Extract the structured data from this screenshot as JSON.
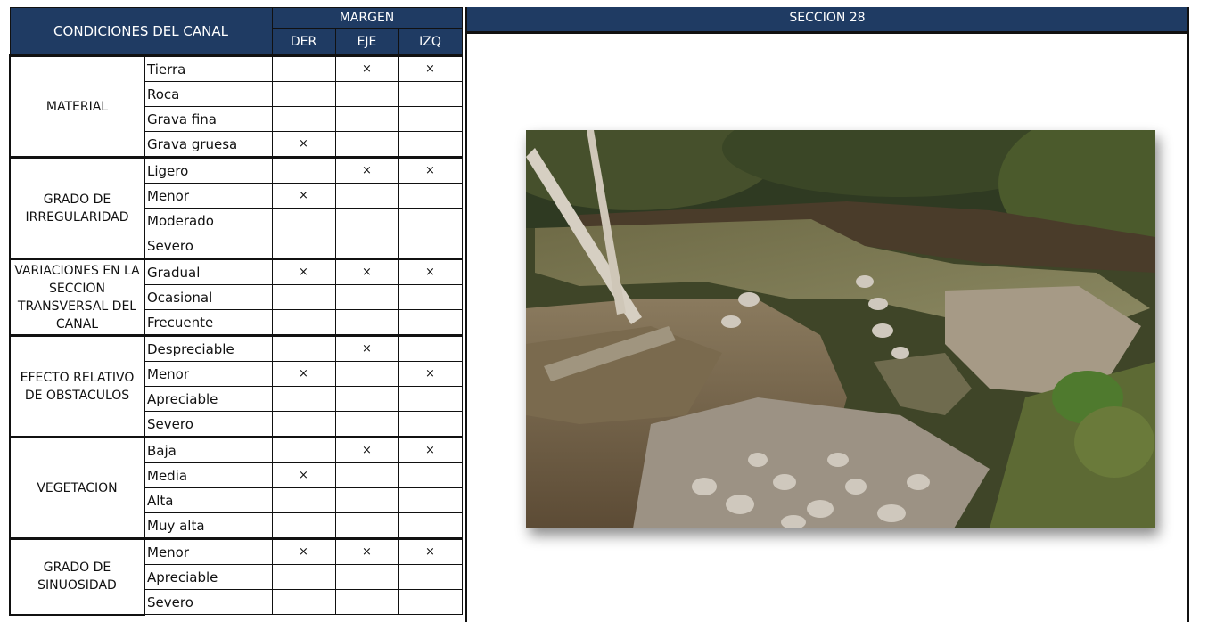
{
  "table": {
    "header_title": "CONDICIONES DEL CANAL",
    "margin_label": "MARGEN",
    "columns": [
      "DER",
      "EJE",
      "IZQ"
    ],
    "mark_symbol": "×",
    "groups": [
      {
        "label": "MATERIAL",
        "rows": [
          {
            "option": "Tierra",
            "marks": [
              false,
              true,
              true
            ]
          },
          {
            "option": "Roca",
            "marks": [
              false,
              false,
              false
            ]
          },
          {
            "option": "Grava fina",
            "marks": [
              false,
              false,
              false
            ]
          },
          {
            "option": "Grava gruesa",
            "marks": [
              true,
              false,
              false
            ]
          }
        ]
      },
      {
        "label": "GRADO DE IRREGULARIDAD",
        "rows": [
          {
            "option": "Ligero",
            "marks": [
              false,
              true,
              true
            ]
          },
          {
            "option": "Menor",
            "marks": [
              true,
              false,
              false
            ]
          },
          {
            "option": "Moderado",
            "marks": [
              false,
              false,
              false
            ]
          },
          {
            "option": "Severo",
            "marks": [
              false,
              false,
              false
            ]
          }
        ]
      },
      {
        "label": "VARIACIONES EN LA SECCION TRANSVERSAL DEL CANAL",
        "rows": [
          {
            "option": "Gradual",
            "marks": [
              true,
              true,
              true
            ]
          },
          {
            "option": "Ocasional",
            "marks": [
              false,
              false,
              false
            ]
          },
          {
            "option": "Frecuente",
            "marks": [
              false,
              false,
              false
            ]
          }
        ]
      },
      {
        "label": "EFECTO RELATIVO DE OBSTACULOS",
        "rows": [
          {
            "option": "Despreciable",
            "marks": [
              false,
              true,
              false
            ]
          },
          {
            "option": "Menor",
            "marks": [
              true,
              false,
              true
            ]
          },
          {
            "option": "Apreciable",
            "marks": [
              false,
              false,
              false
            ]
          },
          {
            "option": "Severo",
            "marks": [
              false,
              false,
              false
            ]
          }
        ]
      },
      {
        "label": "VEGETACION",
        "rows": [
          {
            "option": "Baja",
            "marks": [
              false,
              true,
              true
            ]
          },
          {
            "option": "Media",
            "marks": [
              true,
              false,
              false
            ]
          },
          {
            "option": "Alta",
            "marks": [
              false,
              false,
              false
            ]
          },
          {
            "option": "Muy alta",
            "marks": [
              false,
              false,
              false
            ]
          }
        ]
      },
      {
        "label": "GRADO DE SINUOSIDAD",
        "rows": [
          {
            "option": "Menor",
            "marks": [
              true,
              true,
              true
            ]
          },
          {
            "option": "Apreciable",
            "marks": [
              false,
              false,
              false
            ]
          },
          {
            "option": "Severo",
            "marks": [
              false,
              false,
              false
            ]
          }
        ]
      }
    ]
  },
  "section": {
    "title": "SECCION 28"
  },
  "colors": {
    "header_bg": "#1f3b63",
    "header_text": "#ffffff",
    "border": "#111111"
  }
}
